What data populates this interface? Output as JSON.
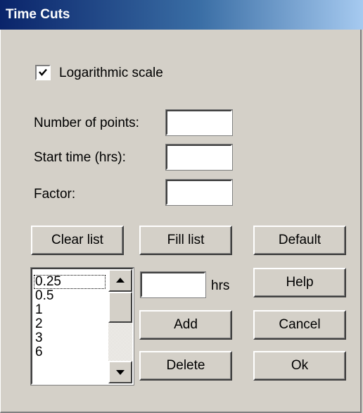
{
  "window": {
    "title": "Time Cuts"
  },
  "options": {
    "log_scale_label": "Logarithmic scale",
    "log_scale_checked": true
  },
  "fields": {
    "num_points_label": "Number of points:",
    "num_points_value": "",
    "start_time_label": "Start time (hrs):",
    "start_time_value": "",
    "factor_label": "Factor:",
    "factor_value": ""
  },
  "buttons": {
    "clear_list": "Clear list",
    "fill_list": "Fill list",
    "default": "Default",
    "help": "Help",
    "add": "Add",
    "cancel": "Cancel",
    "delete": "Delete",
    "ok": "Ok"
  },
  "time_list": {
    "items": [
      "0.25",
      "0.5",
      "1",
      "2",
      "3",
      "6"
    ],
    "selected_index": 0
  },
  "time_entry": {
    "value": "",
    "unit_label": "hrs"
  },
  "icons": {
    "scroll_up": "arrow-up-icon",
    "scroll_down": "arrow-down-icon",
    "check": "checkmark-icon"
  }
}
